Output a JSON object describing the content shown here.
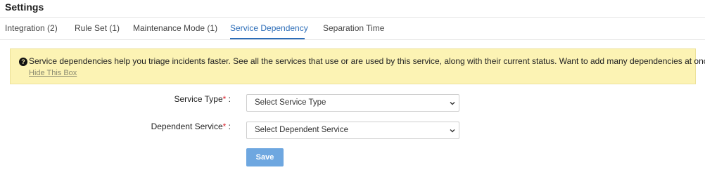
{
  "header": {
    "title": "Settings"
  },
  "tabs": [
    {
      "label": "Integration (2)"
    },
    {
      "label": "Rule Set (1)"
    },
    {
      "label": "Maintenance Mode (1)"
    },
    {
      "label": "Service Dependency"
    },
    {
      "label": "Separation Time"
    }
  ],
  "info": {
    "icon": "question-circle-icon",
    "text": "Service dependencies help you triage incidents faster. See all the services that use or are used by this service, along with their current status. Want to add many dependencies at once?",
    "hide_link": "Hide This Box"
  },
  "form": {
    "service_type": {
      "label": "Service Type",
      "required_mark": "*",
      "colon": ":",
      "value": "Select Service Type"
    },
    "dependent_service": {
      "label": "Dependent Service",
      "required_mark": "*",
      "colon": ":",
      "value": "Select Dependent Service"
    },
    "save_label": "Save"
  },
  "colors": {
    "accent": "#2c6db8",
    "info_bg": "#fcf3b4",
    "required": "#d9232e",
    "button": "#6ea7e0"
  }
}
